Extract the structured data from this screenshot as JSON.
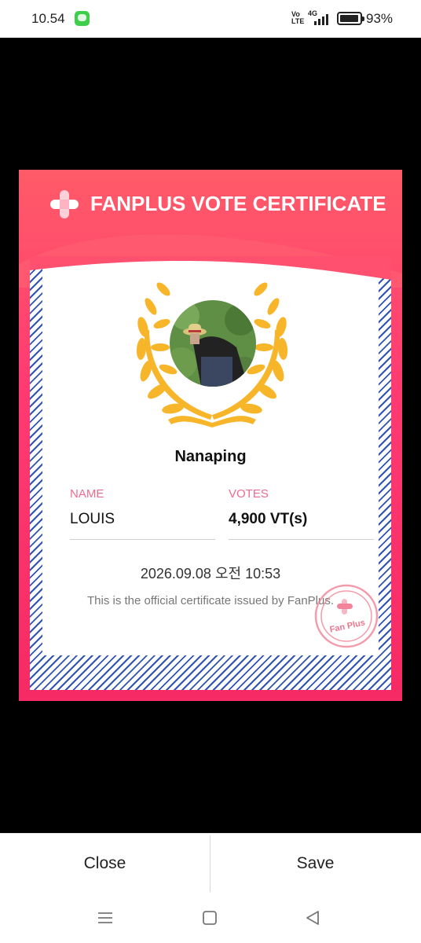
{
  "status_bar": {
    "time": "10.54",
    "volte": "Vo LTE",
    "network": "4G",
    "battery_percent": "93%"
  },
  "certificate": {
    "title": "FANPLUS VOTE CERTIFICATE",
    "supporter_name": "Nanaping",
    "name_label": "NAME",
    "name_value": "LOUIS",
    "votes_label": "VOTES",
    "votes_value": "4,900 VT(s)",
    "issued_at": "2026.09.08 오전 10:53",
    "note": "This is the official certificate issued by FanPlus.",
    "stamp_text": "Fan Plus"
  },
  "dialog_buttons": {
    "close": "Close",
    "save": "Save"
  },
  "nav": {
    "recents_icon": "menu-icon",
    "home_icon": "home-icon",
    "back_icon": "back-icon"
  },
  "colors": {
    "brand_pink": "#f62a64",
    "laurel_gold": "#f7b52a",
    "stripe_blue": "#2f54b5"
  }
}
